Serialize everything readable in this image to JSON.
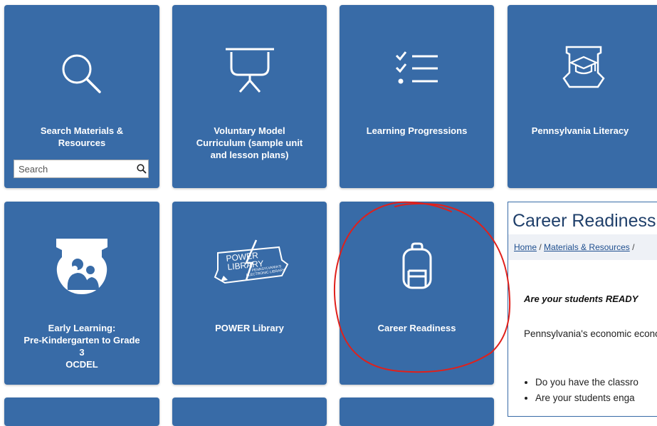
{
  "tiles": {
    "search": {
      "label": "Search Materials &\nResources",
      "icon": "search-icon"
    },
    "curriculum": {
      "label": "Voluntary Model\nCurriculum (sample unit\nand lesson plans)",
      "icon": "presentation-board-icon"
    },
    "progressions": {
      "label": "Learning Progressions",
      "icon": "checklist-icon"
    },
    "literacy": {
      "label": "Pennsylvania Literacy",
      "icon": "keystone-graduation-cap-icon"
    },
    "early": {
      "label": "Early Learning:\nPre-Kindergarten to Grade\n3\nOCDEL",
      "icon": "keystone-family-icon"
    },
    "power": {
      "label": "POWER Library",
      "icon": "power-library-logo"
    },
    "career": {
      "label": "Career Readiness",
      "icon": "backpack-icon"
    }
  },
  "power_logo": {
    "line1": "POWER",
    "line2": "LIBRARY",
    "line3": "PENNSYLVANIA'S",
    "line4": "ELECTRONIC LIBRARY"
  },
  "search": {
    "placeholder": "Search"
  },
  "panel": {
    "title": "Career Readiness",
    "breadcrumb": [
      "Home",
      "Materials & Resources"
    ],
    "separator": "/",
    "question": "Are your students READY",
    "paragraph": "Pennsylvania's economic economy.",
    "bullets": [
      "Do you have the classro",
      "Are your students enga"
    ]
  },
  "colors": {
    "tile": "#386ba7",
    "annotation": "#e0201b",
    "title": "#1f3f6a"
  }
}
